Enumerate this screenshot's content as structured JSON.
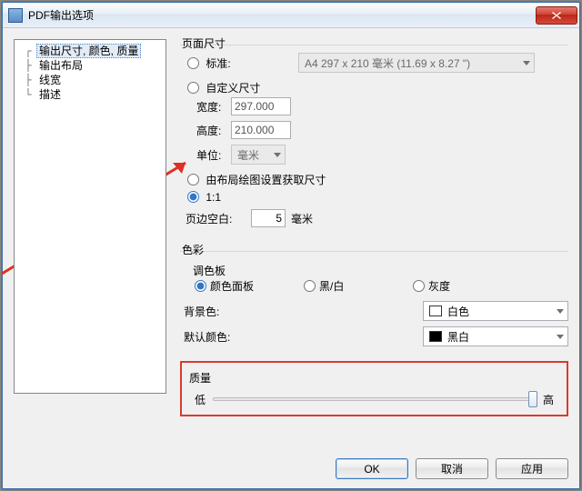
{
  "window_title": "PDF输出选项",
  "tree": {
    "items": [
      {
        "label": "输出尺寸, 颜色, 质量",
        "selected": true
      },
      {
        "label": "输出布局"
      },
      {
        "label": "线宽"
      },
      {
        "label": "描述"
      }
    ]
  },
  "page_size": {
    "legend": "页面尺寸",
    "standard_label": "标准:",
    "custom_label": "自定义尺寸",
    "paper_option": "A4 297 x 210 毫米 (11.69 x 8.27 \")",
    "width_label": "宽度:",
    "width_value": "297.000",
    "height_label": "高度:",
    "height_value": "210.000",
    "unit_label": "单位:",
    "unit_option": "毫米",
    "from_layout_label": "由布局绘图设置获取尺寸",
    "one_to_one_label": "1:1",
    "margin_label": "页边空白:",
    "margin_value": "5",
    "margin_unit": "毫米",
    "selected": "one_to_one"
  },
  "color": {
    "legend": "色彩",
    "palette_legend": "调色板",
    "palette_options": {
      "panel": "颜色面板",
      "bw": "黑/白",
      "gray": "灰度"
    },
    "palette_selected": "panel",
    "bg_label": "背景色:",
    "bg_option": "白色",
    "bg_swatch": "#ffffff",
    "default_label": "默认颜色:",
    "default_option": "黑白",
    "default_swatch": "#000000"
  },
  "quality": {
    "legend": "质量",
    "low_label": "低",
    "high_label": "高",
    "value_pct": 100
  },
  "buttons": {
    "ok": "OK",
    "cancel": "取消",
    "apply": "应用"
  }
}
